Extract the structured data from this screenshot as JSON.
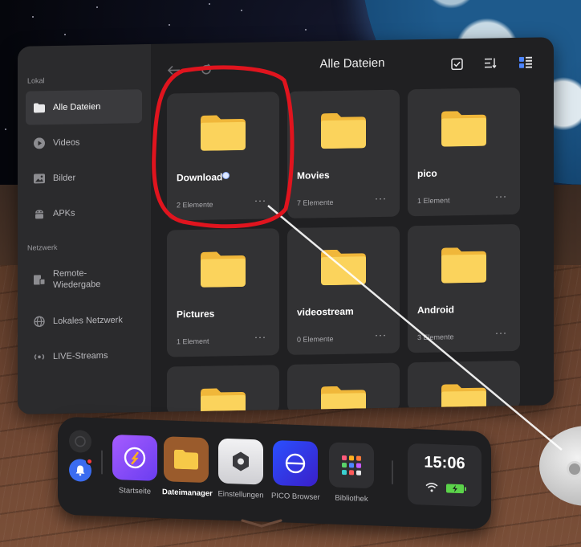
{
  "window": {
    "title": "Alle Dateien"
  },
  "sidebar": {
    "section_local": "Lokal",
    "section_network": "Netzwerk",
    "items": [
      {
        "label": "Alle Dateien",
        "icon": "folder-icon",
        "active": true
      },
      {
        "label": "Videos",
        "icon": "play-circle-icon",
        "active": false
      },
      {
        "label": "Bilder",
        "icon": "image-icon",
        "active": false
      },
      {
        "label": "APKs",
        "icon": "android-icon",
        "active": false
      },
      {
        "label": "Remote-Wiedergabe",
        "icon": "remote-playback-icon",
        "active": false
      },
      {
        "label": "Lokales Netzwerk",
        "icon": "globe-icon",
        "active": false
      },
      {
        "label": "LIVE-Streams",
        "icon": "live-stream-icon",
        "active": false
      }
    ]
  },
  "toolbar": {
    "back_icon": "arrow-left-icon",
    "refresh_icon": "refresh-icon",
    "select_icon": "checkbox-icon",
    "sort_icon": "sort-icon",
    "view_icon": "list-view-icon"
  },
  "folders": [
    {
      "name": "Download",
      "count": "2 Elemente"
    },
    {
      "name": "Movies",
      "count": "7 Elemente"
    },
    {
      "name": "pico",
      "count": "1 Element"
    },
    {
      "name": "Pictures",
      "count": "1 Element"
    },
    {
      "name": "videostream",
      "count": "0 Elemente"
    },
    {
      "name": "Android",
      "count": "3 Elemente"
    }
  ],
  "folder_more_label": "···",
  "dock": {
    "apps": [
      {
        "label": "Startseite",
        "icon": "compass-icon",
        "active": false
      },
      {
        "label": "Dateimanager",
        "icon": "folder-icon",
        "active": true
      },
      {
        "label": "Einstellungen",
        "icon": "settings-hex-icon",
        "active": false
      },
      {
        "label": "PICO Browser",
        "icon": "browser-icon",
        "active": false
      },
      {
        "label": "Bibliothek",
        "icon": "grid-icon",
        "active": false
      }
    ],
    "clock": "15:06"
  },
  "colors": {
    "panel_bg": "#202022",
    "sidebar_bg": "#2b2b2d",
    "tile_bg": "#323234",
    "folder_yellow": "#f7c948",
    "annotation_red": "#e0141e"
  }
}
